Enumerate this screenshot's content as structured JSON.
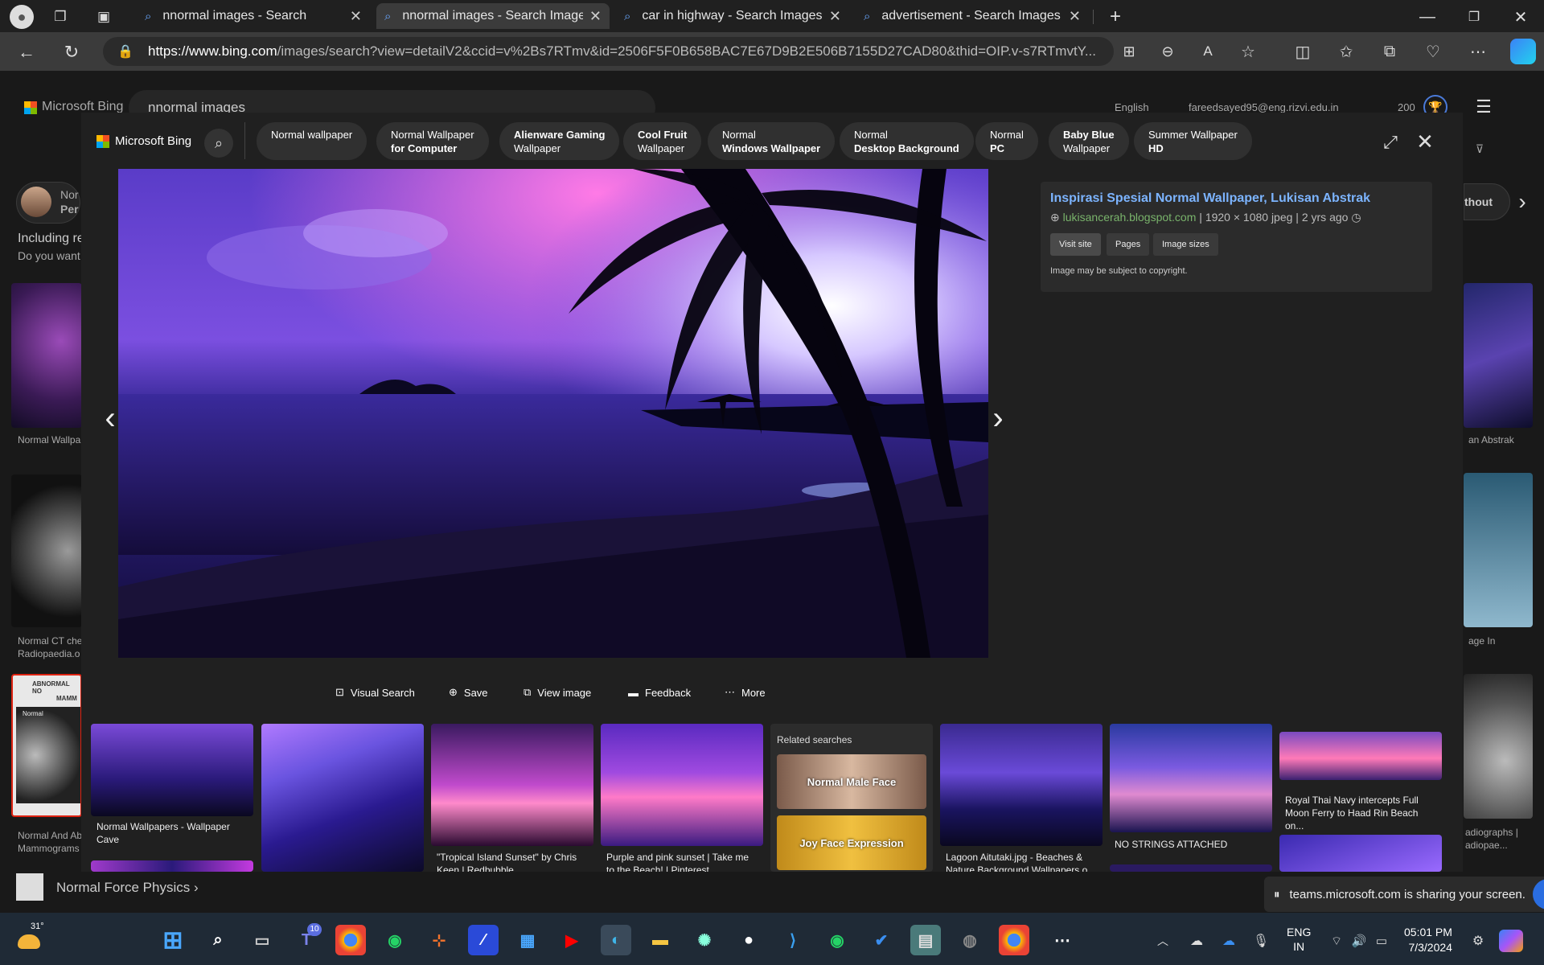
{
  "tabs": [
    {
      "title": "nnormal images - Search"
    },
    {
      "title": "nnormal images - Search Images"
    },
    {
      "title": "car in highway - Search Images"
    },
    {
      "title": "advertisement - Search Images"
    }
  ],
  "url": {
    "host": "https://www.bing.com",
    "path": "/images/search?view=detailV2&ccid=v%2Bs7RTmv&id=2506F5F0B658BAC7E67D9B2E506B7155D27CAD80&thid=OIP.v-s7RTmvtY..."
  },
  "background_page": {
    "logo": "Microsoft Bing",
    "search_value": "nnormal images",
    "language": "English",
    "user_email": "fareedsayed95@eng.rizvi.edu.in",
    "points": "200",
    "left_partial": {
      "person_label": "Nor",
      "person_label2": "Per",
      "including": "Including re",
      "want": "Do you want",
      "cap1": "Normal Wallpa",
      "cap2a": "Normal CT che",
      "cap2b": "Radiopaedia.o",
      "cap3a": "Normal And Ab",
      "cap3b": "Mammograms",
      "mammo_title": "ABNORMAL NO",
      "mammo_title2": "MAMM",
      "mammo_label": "Normal"
    },
    "right_partial": {
      "chip": "thout",
      "cap1": "an Abstrak",
      "cap2": "age In",
      "cap3a": "adiographs |",
      "cap3b": "adiopae..."
    },
    "bottom_suggestion": "Normal Force Physics"
  },
  "overlay": {
    "logo_text": "Microsoft Bing",
    "chips": [
      {
        "l1": "Normal wallpaper",
        "l2": "",
        "bold2": false
      },
      {
        "l1": "Normal Wallpaper",
        "l2": "for Computer",
        "bold2": true
      },
      {
        "l1": "Alienware Gaming",
        "l2": "Wallpaper",
        "bold1": true
      },
      {
        "l1": "Cool Fruit",
        "l2": "Wallpaper",
        "bold1": true
      },
      {
        "l1": "Normal",
        "l2": "Windows Wallpaper",
        "bold2": true
      },
      {
        "l1": "Normal",
        "l2": "Desktop Background",
        "bold2": true
      },
      {
        "l1": "Normal",
        "l2": "PC",
        "bold2": true
      },
      {
        "l1": "Baby Blue",
        "l2": "Wallpaper",
        "bold1": true
      },
      {
        "l1": "Summer Wallpaper",
        "l2": "HD",
        "bold2": true
      }
    ],
    "info": {
      "title": "Inspirasi Spesial Normal Wallpaper, Lukisan Abstrak",
      "domain": "lukisancerah.blogspot.com",
      "dims": "1920 × 1080 jpeg",
      "age": "2 yrs ago",
      "visit": "Visit site",
      "pages": "Pages",
      "sizes": "Image sizes",
      "copyright": "Image may be subject to copyright."
    },
    "actions": {
      "visual": "Visual Search",
      "save": "Save",
      "view": "View image",
      "feedback": "Feedback",
      "more": "More"
    },
    "strip": {
      "t1": "Normal Wallpapers - Wallpaper Cave",
      "t3": "\"Tropical Island Sunset\" by Chris Keen | Redbubble",
      "t4": "Purple and pink sunset | Take me to the Beach! | Pinterest",
      "related_title": "Related searches",
      "rel1": "Normal Male Face",
      "rel2": "Joy Face Expression",
      "t5": "Lagoon Aitutaki.jpg - Beaches & Nature Background Wallpapers o...",
      "t6": "NO STRINGS ATTACHED",
      "t7": "Royal Thai Navy intercepts Full Moon Ferry to Haad Rin Beach on..."
    }
  },
  "sharing": "teams.microsoft.com is sharing your screen.",
  "taskbar": {
    "weather": "31°",
    "teams_badge": "10",
    "lang1": "ENG",
    "lang2": "IN",
    "time": "05:01 PM",
    "date": "7/3/2024"
  }
}
